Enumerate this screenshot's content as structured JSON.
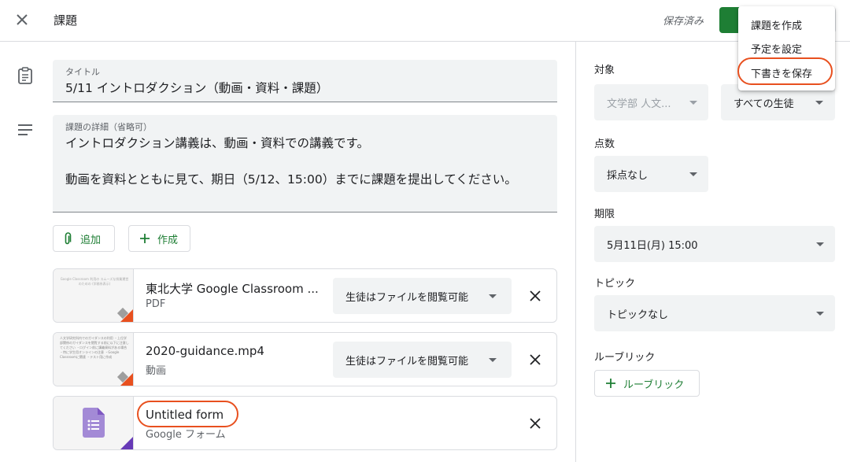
{
  "header": {
    "title": "課題",
    "saved_status": "保存済み"
  },
  "menu": {
    "items": [
      "課題を作成",
      "予定を設定",
      "下書きを保存"
    ]
  },
  "form": {
    "title_label": "タイトル",
    "title_value": "5/11 イントロダクション（動画・資料・課題）",
    "details_label": "課題の詳細（省略可）",
    "details_line1": "イントロダクション講義は、動画・資料での講義です。",
    "details_line2": "動画を資料とともに見て、期日（5/12、15:00）までに課題を提出してください。"
  },
  "buttons": {
    "add": "追加",
    "create": "作成"
  },
  "attachments": [
    {
      "title": "東北大学 Google Classroom ...",
      "type": "PDF",
      "permission": "生徒はファイルを閲覧可能",
      "thumb_text": "Google Classroom 利用の スムーズな授業運営のための (学務系表示)"
    },
    {
      "title": "2020-guidance.mp4",
      "type": "動画",
      "permission": "生徒はファイルを閲覧可能",
      "thumb_text": "人文学研究科内でのガイダンスの利用 ・上位学部関係のガイダンスを閲覧する前に以下に注意してください ・ログイン前に講義資料がある場合 ・特に学生用オンラインの注意 ・Google Classroomに関連 ・テスト用に作成"
    },
    {
      "title": "Untitled form",
      "type": "Google フォーム"
    }
  ],
  "sidebar": {
    "target_label": "対象",
    "class_value": "文学部 人文...",
    "students_value": "すべての生徒",
    "points_label": "点数",
    "points_value": "採点なし",
    "due_label": "期限",
    "due_value": "5月11日(月) 15:00",
    "topic_label": "トピック",
    "topic_value": "トピックなし",
    "rubric_label": "ルーブリック",
    "rubric_button": "ルーブリック"
  },
  "colors": {
    "accent": "#1e7e34",
    "annotation": "#e8501f",
    "forms_purple": "#7e57c2"
  }
}
